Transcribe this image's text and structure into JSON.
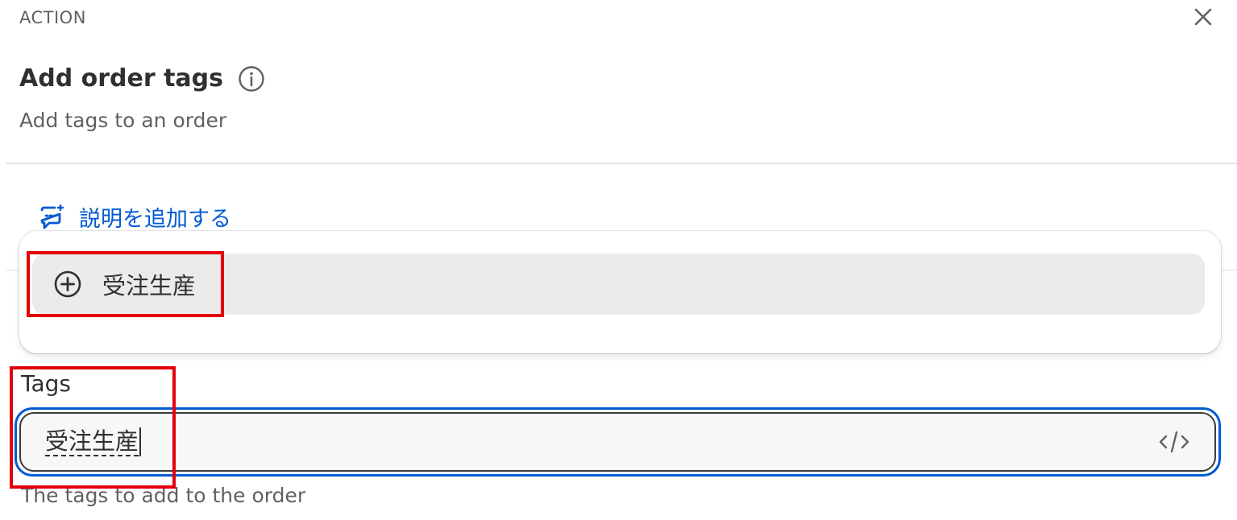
{
  "header": {
    "section_label": "ACTION",
    "title": "Add order tags",
    "subtitle": "Add tags to an order"
  },
  "add_description": {
    "label": "説明を追加する"
  },
  "dropdown": {
    "options": [
      {
        "label": "受注生産",
        "icon": "plus-circle-icon"
      }
    ]
  },
  "tags_field": {
    "label": "Tags",
    "value": "受注生産",
    "help_text": "The tags to add to the order"
  },
  "colors": {
    "accent": "#005bd3",
    "highlight_box": "#e3000b",
    "option_bg": "#ebebeb"
  }
}
